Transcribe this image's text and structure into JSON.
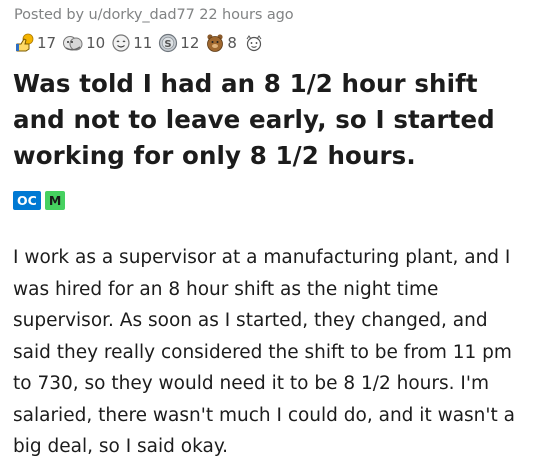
{
  "post": {
    "posted_prefix": "Posted by",
    "author": "u/dorky_dad77",
    "time_ago": "22 hours ago",
    "awards": [
      {
        "icon": "helpful-award-icon",
        "count": "17"
      },
      {
        "icon": "hugz-award-icon",
        "count": "10"
      },
      {
        "icon": "wholesome-award-icon",
        "count": "11"
      },
      {
        "icon": "silver-award-icon",
        "count": "12"
      },
      {
        "icon": "bravo-award-icon",
        "count": "8"
      },
      {
        "icon": "more-awards-icon",
        "count": ""
      }
    ],
    "title": "Was told I had an 8 1/2 hour shift and not to leave early, so I started working for only 8 1/2 hours.",
    "flairs": {
      "oc": "OC",
      "m": "M"
    },
    "body": "I work as a supervisor at a manufacturing plant, and I was hired for an 8 hour shift as the night time supervisor. As soon as I started, they changed, and said they really considered the shift to be from 11 pm to 730, so they would need it to be 8 1/2 hours. I'm salaried, there wasn't much I could do, and it wasn't a big deal, so I said okay."
  },
  "colors": {
    "oc_flair": "#0079d3",
    "m_flair": "#46d160",
    "meta_text": "#818384",
    "title_text": "#1c1c1c"
  }
}
